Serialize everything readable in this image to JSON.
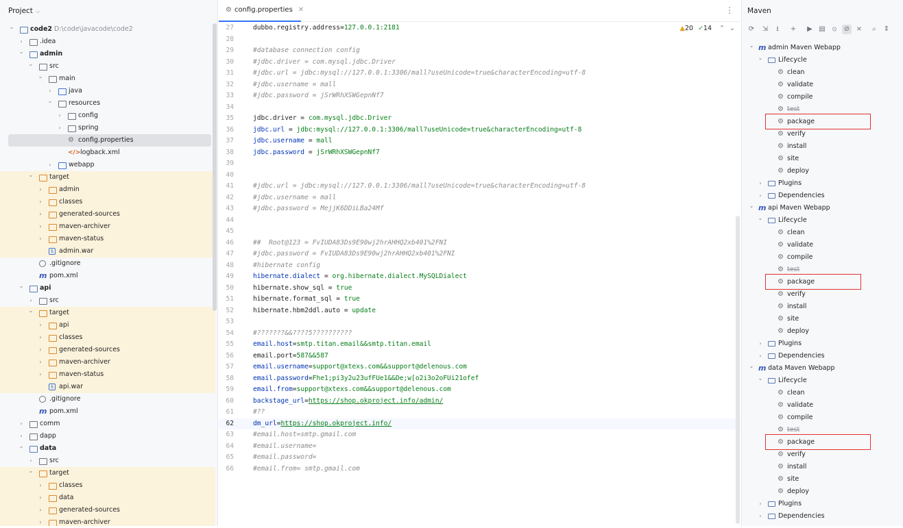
{
  "project": {
    "title": "Project",
    "tree": [
      {
        "label": "code2",
        "hint": "D:\\code\\javacode\\code2",
        "depth": 0,
        "arrow": "open",
        "icon": "module-folder",
        "bold": true
      },
      {
        "label": ".idea",
        "depth": 1,
        "arrow": "closed",
        "icon": "folder"
      },
      {
        "label": "admin",
        "depth": 1,
        "arrow": "open",
        "icon": "module-folder",
        "bold": true
      },
      {
        "label": "src",
        "depth": 2,
        "arrow": "open",
        "icon": "folder"
      },
      {
        "label": "main",
        "depth": 3,
        "arrow": "open",
        "icon": "folder"
      },
      {
        "label": "java",
        "depth": 4,
        "arrow": "closed",
        "icon": "source-folder"
      },
      {
        "label": "resources",
        "depth": 4,
        "arrow": "open",
        "icon": "resources-folder"
      },
      {
        "label": "config",
        "depth": 5,
        "arrow": "closed",
        "icon": "folder"
      },
      {
        "label": "spring",
        "depth": 5,
        "arrow": "closed",
        "icon": "folder"
      },
      {
        "label": "config.properties",
        "depth": 5,
        "arrow": "none",
        "icon": "gear-file",
        "selected": true
      },
      {
        "label": "logback.xml",
        "depth": 5,
        "arrow": "none",
        "icon": "xml-file"
      },
      {
        "label": "webapp",
        "depth": 4,
        "arrow": "closed",
        "icon": "web-folder"
      },
      {
        "label": "target",
        "depth": 2,
        "arrow": "open",
        "icon": "excluded-folder",
        "excluded": true
      },
      {
        "label": "admin",
        "depth": 3,
        "arrow": "closed",
        "icon": "excluded-folder",
        "excluded": true
      },
      {
        "label": "classes",
        "depth": 3,
        "arrow": "closed",
        "icon": "excluded-folder",
        "excluded": true
      },
      {
        "label": "generated-sources",
        "depth": 3,
        "arrow": "closed",
        "icon": "excluded-folder",
        "excluded": true
      },
      {
        "label": "maven-archiver",
        "depth": 3,
        "arrow": "closed",
        "icon": "excluded-folder",
        "excluded": true
      },
      {
        "label": "maven-status",
        "depth": 3,
        "arrow": "closed",
        "icon": "excluded-folder",
        "excluded": true
      },
      {
        "label": "admin.war",
        "depth": 3,
        "arrow": "none",
        "icon": "war-file",
        "excluded": true
      },
      {
        "label": ".gitignore",
        "depth": 2,
        "arrow": "none",
        "icon": "ignore-file"
      },
      {
        "label": "pom.xml",
        "depth": 2,
        "arrow": "none",
        "icon": "maven-file"
      },
      {
        "label": "api",
        "depth": 1,
        "arrow": "open",
        "icon": "module-folder",
        "bold": true
      },
      {
        "label": "src",
        "depth": 2,
        "arrow": "closed",
        "icon": "folder"
      },
      {
        "label": "target",
        "depth": 2,
        "arrow": "open",
        "icon": "excluded-folder",
        "excluded": true
      },
      {
        "label": "api",
        "depth": 3,
        "arrow": "closed",
        "icon": "excluded-folder",
        "excluded": true
      },
      {
        "label": "classes",
        "depth": 3,
        "arrow": "closed",
        "icon": "excluded-folder",
        "excluded": true
      },
      {
        "label": "generated-sources",
        "depth": 3,
        "arrow": "closed",
        "icon": "excluded-folder",
        "excluded": true
      },
      {
        "label": "maven-archiver",
        "depth": 3,
        "arrow": "closed",
        "icon": "excluded-folder",
        "excluded": true
      },
      {
        "label": "maven-status",
        "depth": 3,
        "arrow": "closed",
        "icon": "excluded-folder",
        "excluded": true
      },
      {
        "label": "api.war",
        "depth": 3,
        "arrow": "none",
        "icon": "war-file",
        "excluded": true
      },
      {
        "label": ".gitignore",
        "depth": 2,
        "arrow": "none",
        "icon": "ignore-file"
      },
      {
        "label": "pom.xml",
        "depth": 2,
        "arrow": "none",
        "icon": "maven-file"
      },
      {
        "label": "comm",
        "depth": 1,
        "arrow": "closed",
        "icon": "folder"
      },
      {
        "label": "dapp",
        "depth": 1,
        "arrow": "closed",
        "icon": "folder"
      },
      {
        "label": "data",
        "depth": 1,
        "arrow": "open",
        "icon": "module-folder",
        "bold": true
      },
      {
        "label": "src",
        "depth": 2,
        "arrow": "closed",
        "icon": "folder"
      },
      {
        "label": "target",
        "depth": 2,
        "arrow": "open",
        "icon": "excluded-folder",
        "excluded": true
      },
      {
        "label": "classes",
        "depth": 3,
        "arrow": "closed",
        "icon": "excluded-folder",
        "excluded": true
      },
      {
        "label": "data",
        "depth": 3,
        "arrow": "closed",
        "icon": "excluded-folder",
        "excluded": true
      },
      {
        "label": "generated-sources",
        "depth": 3,
        "arrow": "closed",
        "icon": "excluded-folder",
        "excluded": true
      },
      {
        "label": "maven-archiver",
        "depth": 3,
        "arrow": "closed",
        "icon": "excluded-folder",
        "excluded": true
      }
    ]
  },
  "editor": {
    "tab_label": "config.properties",
    "inspections": {
      "warnings": "20",
      "ok": "14"
    },
    "current_line": "62",
    "lines": [
      {
        "n": "27",
        "parts": [
          [
            "plain",
            "dubbo.registry.address="
          ],
          [
            "val",
            "127.0.0.1:2181"
          ]
        ]
      },
      {
        "n": "28",
        "parts": []
      },
      {
        "n": "29",
        "parts": [
          [
            "comment",
            "#database connection config"
          ]
        ]
      },
      {
        "n": "30",
        "parts": [
          [
            "comment",
            "#jdbc.driver = com.mysql.jdbc.Driver"
          ]
        ]
      },
      {
        "n": "31",
        "parts": [
          [
            "comment",
            "#jdbc.url = jdbc:mysql://127.0.0.1:3306/mall?useUnicode=true&characterEncoding=utf-8"
          ]
        ]
      },
      {
        "n": "32",
        "parts": [
          [
            "comment",
            "#jdbc.username = mall"
          ]
        ]
      },
      {
        "n": "33",
        "parts": [
          [
            "comment",
            "#jdbc.password = jSrWRhXSWGepnNf7"
          ]
        ]
      },
      {
        "n": "34",
        "parts": []
      },
      {
        "n": "35",
        "parts": [
          [
            "plain",
            "jdbc.driver = "
          ],
          [
            "val",
            "com.mysql.jdbc.Driver"
          ]
        ]
      },
      {
        "n": "36",
        "parts": [
          [
            "key",
            "jdbc.url"
          ],
          [
            "plain",
            " = "
          ],
          [
            "val",
            "jdbc:mysql://127.0.0.1:3306/mall?useUnicode=true&characterEncoding=utf-8"
          ]
        ]
      },
      {
        "n": "37",
        "parts": [
          [
            "key",
            "jdbc.username"
          ],
          [
            "plain",
            " = "
          ],
          [
            "val",
            "mall"
          ]
        ]
      },
      {
        "n": "38",
        "parts": [
          [
            "key",
            "jdbc.password"
          ],
          [
            "plain",
            " = "
          ],
          [
            "val",
            "jSrWRhXSWGepnNf7"
          ]
        ]
      },
      {
        "n": "39",
        "parts": []
      },
      {
        "n": "40",
        "parts": []
      },
      {
        "n": "41",
        "parts": [
          [
            "comment",
            "#jdbc.url = jdbc:mysql://127.0.0.1:3306/mall?useUnicode=true&characterEncoding=utf-8"
          ]
        ]
      },
      {
        "n": "42",
        "parts": [
          [
            "comment",
            "#jdbc.username = mall"
          ]
        ]
      },
      {
        "n": "43",
        "parts": [
          [
            "comment",
            "#jdbc.password = MejjK6DDiLBa24Mf"
          ]
        ]
      },
      {
        "n": "44",
        "parts": []
      },
      {
        "n": "45",
        "parts": []
      },
      {
        "n": "46",
        "parts": [
          [
            "comment",
            "##  Root@123 = FvIUDA83Ds9E90wj2hrAHHQ2xb401%2FNI"
          ]
        ]
      },
      {
        "n": "47",
        "parts": [
          [
            "comment",
            "#jdbc.password = FvIUDA83Ds9E90wj2hrAHHQ2xb401%2FNI"
          ]
        ]
      },
      {
        "n": "48",
        "parts": [
          [
            "comment",
            "#hibernate config"
          ]
        ]
      },
      {
        "n": "49",
        "parts": [
          [
            "key",
            "hibernate.dialect"
          ],
          [
            "plain",
            " = "
          ],
          [
            "val",
            "org.hibernate.dialect.MySQLDialect"
          ]
        ]
      },
      {
        "n": "50",
        "parts": [
          [
            "plain",
            "hibernate.show_sql = "
          ],
          [
            "val",
            "true"
          ]
        ]
      },
      {
        "n": "51",
        "parts": [
          [
            "plain",
            "hibernate.format_sql = "
          ],
          [
            "val",
            "true"
          ]
        ]
      },
      {
        "n": "52",
        "parts": [
          [
            "plain",
            "hibernate.hbm2ddl.auto = "
          ],
          [
            "val",
            "update"
          ]
        ]
      },
      {
        "n": "53",
        "parts": []
      },
      {
        "n": "54",
        "parts": [
          [
            "comment",
            "#???????&&????5??????????"
          ]
        ]
      },
      {
        "n": "55",
        "parts": [
          [
            "key",
            "email.host"
          ],
          [
            "plain",
            "="
          ],
          [
            "val",
            "smtp.titan.email&&smtp.titan.email"
          ]
        ]
      },
      {
        "n": "56",
        "parts": [
          [
            "plain",
            "email.port="
          ],
          [
            "val",
            "587&&587"
          ]
        ]
      },
      {
        "n": "57",
        "parts": [
          [
            "key",
            "email.username"
          ],
          [
            "plain",
            "="
          ],
          [
            "val",
            "support@xtexs.com&&support@delenous.com"
          ]
        ]
      },
      {
        "n": "58",
        "parts": [
          [
            "key",
            "email.password"
          ],
          [
            "plain",
            "="
          ],
          [
            "val",
            "Fhe1;pi3y2u23ufFUe1&&De;w[o2i3o2oFUi21ofef"
          ]
        ]
      },
      {
        "n": "59",
        "parts": [
          [
            "key",
            "email.from"
          ],
          [
            "plain",
            "="
          ],
          [
            "val",
            "support@xtexs.com&&support@delenous.com"
          ]
        ]
      },
      {
        "n": "60",
        "parts": [
          [
            "key",
            "backstage_url"
          ],
          [
            "plain",
            "="
          ],
          [
            "link",
            "https://shop.okproject.info/admin/"
          ]
        ]
      },
      {
        "n": "61",
        "parts": [
          [
            "comment",
            "#??"
          ]
        ]
      },
      {
        "n": "62",
        "parts": [
          [
            "key",
            "dm_url"
          ],
          [
            "plain",
            "="
          ],
          [
            "link",
            "https://shop.okproject.info/"
          ]
        ]
      },
      {
        "n": "63",
        "parts": [
          [
            "comment",
            "#email.host=smtp.gmail.com"
          ]
        ]
      },
      {
        "n": "64",
        "parts": [
          [
            "comment",
            "#email.username="
          ]
        ]
      },
      {
        "n": "65",
        "parts": [
          [
            "comment",
            "#email.password="
          ]
        ]
      },
      {
        "n": "66",
        "parts": [
          [
            "comment",
            "#email.from= smtp.gmail.com"
          ]
        ]
      }
    ]
  },
  "maven": {
    "title": "Maven",
    "toolbar_icons": [
      "refresh-icon",
      "reimport-icon",
      "download-icon",
      "add-icon",
      "run-icon",
      "execute-goal-icon",
      "toggle-offline-icon",
      "skip-tests-icon",
      "collapse-all-icon",
      "find-icon",
      "expand-icon"
    ],
    "projects": [
      {
        "name": "admin Maven Webapp",
        "lifecycle_label": "Lifecycle",
        "goals": [
          "clean",
          "validate",
          "compile",
          "test",
          "package",
          "verify",
          "install",
          "site",
          "deploy"
        ],
        "plugins_label": "Plugins",
        "dependencies_label": "Dependencies"
      },
      {
        "name": "api Maven Webapp",
        "lifecycle_label": "Lifecycle",
        "goals": [
          "clean",
          "validate",
          "compile",
          "test",
          "package",
          "verify",
          "install",
          "site",
          "deploy"
        ],
        "plugins_label": "Plugins",
        "dependencies_label": "Dependencies"
      },
      {
        "name": "data Maven Webapp",
        "lifecycle_label": "Lifecycle",
        "goals": [
          "clean",
          "validate",
          "compile",
          "test",
          "package",
          "verify",
          "install",
          "site",
          "deploy"
        ],
        "plugins_label": "Plugins",
        "dependencies_label": "Dependencies"
      }
    ],
    "struck_goal": "test",
    "highlighted_goal": "package"
  },
  "colors": {
    "accent": "#3574f0",
    "highlight_box": "#e0302f",
    "excluded_bg": "#fcf3dc"
  }
}
